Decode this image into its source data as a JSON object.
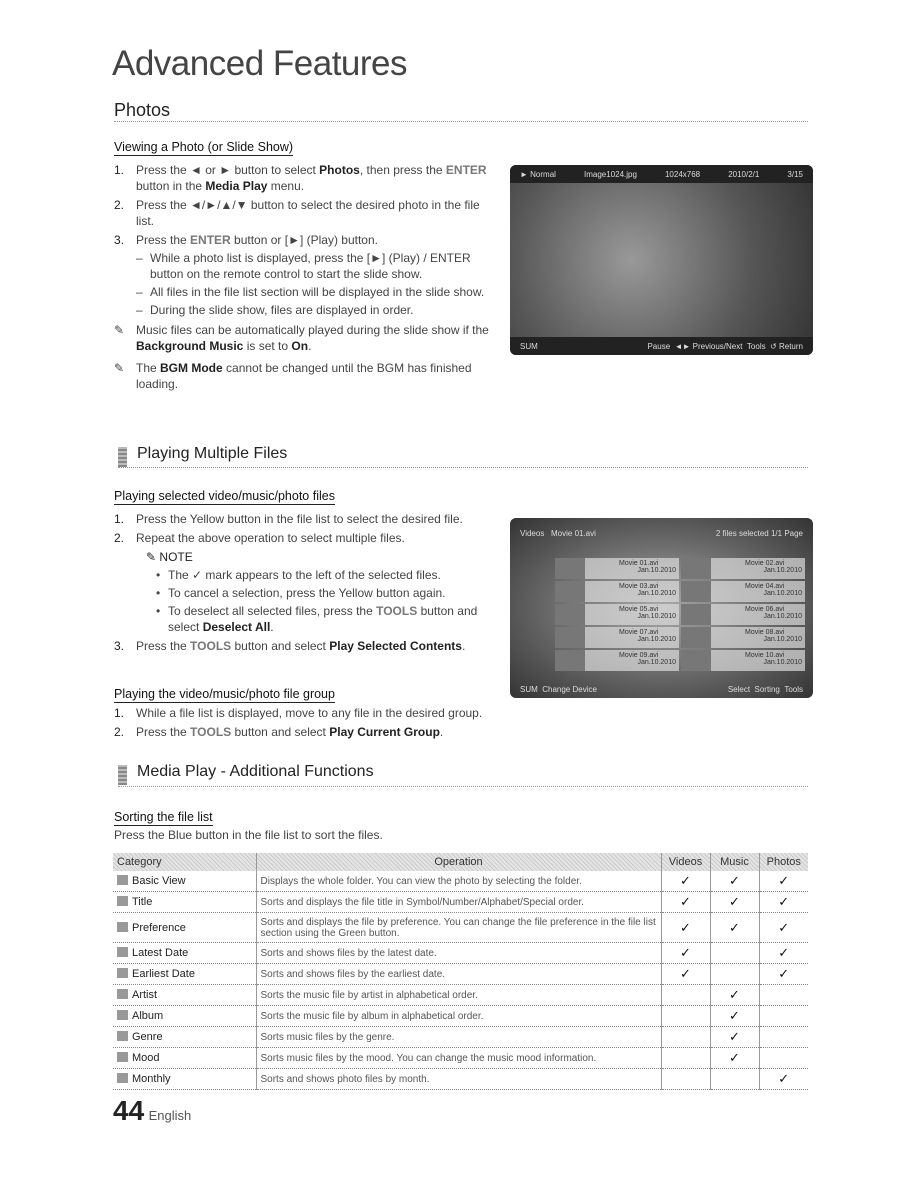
{
  "page_title": "Advanced Features",
  "photos": {
    "heading": "Photos",
    "sub": "Viewing a Photo (or Slide Show)",
    "steps": [
      {
        "n": "1.",
        "pre": "Press the ◄ or ► button to select ",
        "b1": "Photos",
        "mid": ", then press the ",
        "key": "ENTER",
        "post": " button in the ",
        "b2": "Media Play",
        "end": " menu."
      },
      {
        "n": "2.",
        "text": "Press the ◄/►/▲/▼ button to select the desired photo in the file list."
      },
      {
        "n": "3.",
        "pre": "Press the ",
        "key": "ENTER",
        "post": " button or [►] (Play) button."
      }
    ],
    "dashes": [
      "While a photo list is displayed, press the [►] (Play) / ENTER button on the remote control to start the slide show.",
      "All files in the file list section will be displayed in the slide show.",
      "During the slide show, files are displayed in order."
    ],
    "note1": {
      "pre": "Music files can be automatically played during the slide show if the ",
      "b": "Background Music",
      "mid": " is set to ",
      "b2": "On",
      "end": "."
    },
    "note2": {
      "pre": "The ",
      "b": "BGM Mode",
      "end": " cannot be changed until the BGM has finished loading."
    },
    "screen": {
      "mode": "► Normal",
      "file": "Image1024.jpg",
      "res": "1024x768",
      "date": "2010/2/1",
      "count": "3/15",
      "sum": "SUM",
      "pause": "Pause",
      "prevnext": "Previous/Next",
      "tools": "Tools",
      "return": "Return"
    }
  },
  "multi": {
    "heading": "Playing Multiple Files",
    "sub1": "Playing selected video/music/photo files",
    "s1": "Press the Yellow button in the file list to select the desired file.",
    "s2": "Repeat the above operation to select multiple files.",
    "note": "NOTE",
    "bul1": "The ✓ mark appears to the left of the selected files.",
    "bul2": "To cancel a selection, press the Yellow button again.",
    "bul3_pre": "To deselect all selected files, press the ",
    "bul3_key": "TOOLS",
    "bul3_mid": " button and select ",
    "bul3_b": "Deselect All",
    "bul3_end": ".",
    "s3_pre": "Press the ",
    "s3_key": "TOOLS",
    "s3_mid": " button and select ",
    "s3_b": "Play Selected Contents",
    "s3_end": ".",
    "sub2": "Playing the video/music/photo file group",
    "g1": "While a file list is displayed, move to any file in the desired group.",
    "g2_pre": "Press the ",
    "g2_key": "TOOLS",
    "g2_mid": " button and select ",
    "g2_b": "Play Current Group",
    "g2_end": ".",
    "screen": {
      "section": "Videos",
      "file": "Movie 01.avi",
      "status": "2 files selected  1/1 Page",
      "items": [
        {
          "name": "Movie 01.avi",
          "date": "Jan.10.2010"
        },
        {
          "name": "Movie 02.avi",
          "date": "Jan.10.2010"
        },
        {
          "name": "Movie 03.avi",
          "date": "Jan.10.2010"
        },
        {
          "name": "Movie 04.avi",
          "date": "Jan.10.2010"
        },
        {
          "name": "Movie 05.avi",
          "date": "Jan.10.2010"
        },
        {
          "name": "Movie 06.avi",
          "date": "Jan.10.2010"
        },
        {
          "name": "Movie 07.avi",
          "date": "Jan.10.2010"
        },
        {
          "name": "Movie 08.avi",
          "date": "Jan.10.2010"
        },
        {
          "name": "Movie 09.avi",
          "date": "Jan.10.2010"
        },
        {
          "name": "Movie 10.avi",
          "date": "Jan.10.2010"
        }
      ],
      "sum": "SUM",
      "change": "Change Device",
      "select": "Select",
      "sorting": "Sorting",
      "tools": "Tools"
    }
  },
  "extra": {
    "heading": "Media Play - Additional Functions",
    "sub": "Sorting the file list",
    "desc": "Press the Blue button in the file list to sort the files.",
    "headers": [
      "Category",
      "Operation",
      "Videos",
      "Music",
      "Photos"
    ],
    "rows": [
      {
        "cat": "Basic View",
        "op": "Displays the whole folder. You can view the photo by selecting the folder.",
        "v": "✓",
        "m": "✓",
        "p": "✓"
      },
      {
        "cat": "Title",
        "op": "Sorts and displays the file title in Symbol/Number/Alphabet/Special order.",
        "v": "✓",
        "m": "✓",
        "p": "✓"
      },
      {
        "cat": "Preference",
        "op": "Sorts and displays the file by preference. You can change the file preference in the file list section using the Green button.",
        "v": "✓",
        "m": "✓",
        "p": "✓"
      },
      {
        "cat": "Latest Date",
        "op": "Sorts and shows files by the latest date.",
        "v": "✓",
        "m": "",
        "p": "✓"
      },
      {
        "cat": "Earliest Date",
        "op": "Sorts and shows files by the earliest date.",
        "v": "✓",
        "m": "",
        "p": "✓"
      },
      {
        "cat": "Artist",
        "op": "Sorts the music file by artist in alphabetical order.",
        "v": "",
        "m": "✓",
        "p": ""
      },
      {
        "cat": "Album",
        "op": "Sorts the music file by album in alphabetical order.",
        "v": "",
        "m": "✓",
        "p": ""
      },
      {
        "cat": "Genre",
        "op": "Sorts music files by the genre.",
        "v": "",
        "m": "✓",
        "p": ""
      },
      {
        "cat": "Mood",
        "op": "Sorts music files by the mood. You can change the music mood information.",
        "v": "",
        "m": "✓",
        "p": ""
      },
      {
        "cat": "Monthly",
        "op": "Sorts and shows photo files by month.",
        "v": "",
        "m": "",
        "p": "✓"
      }
    ]
  },
  "footer": {
    "page": "44",
    "lang": "English"
  }
}
